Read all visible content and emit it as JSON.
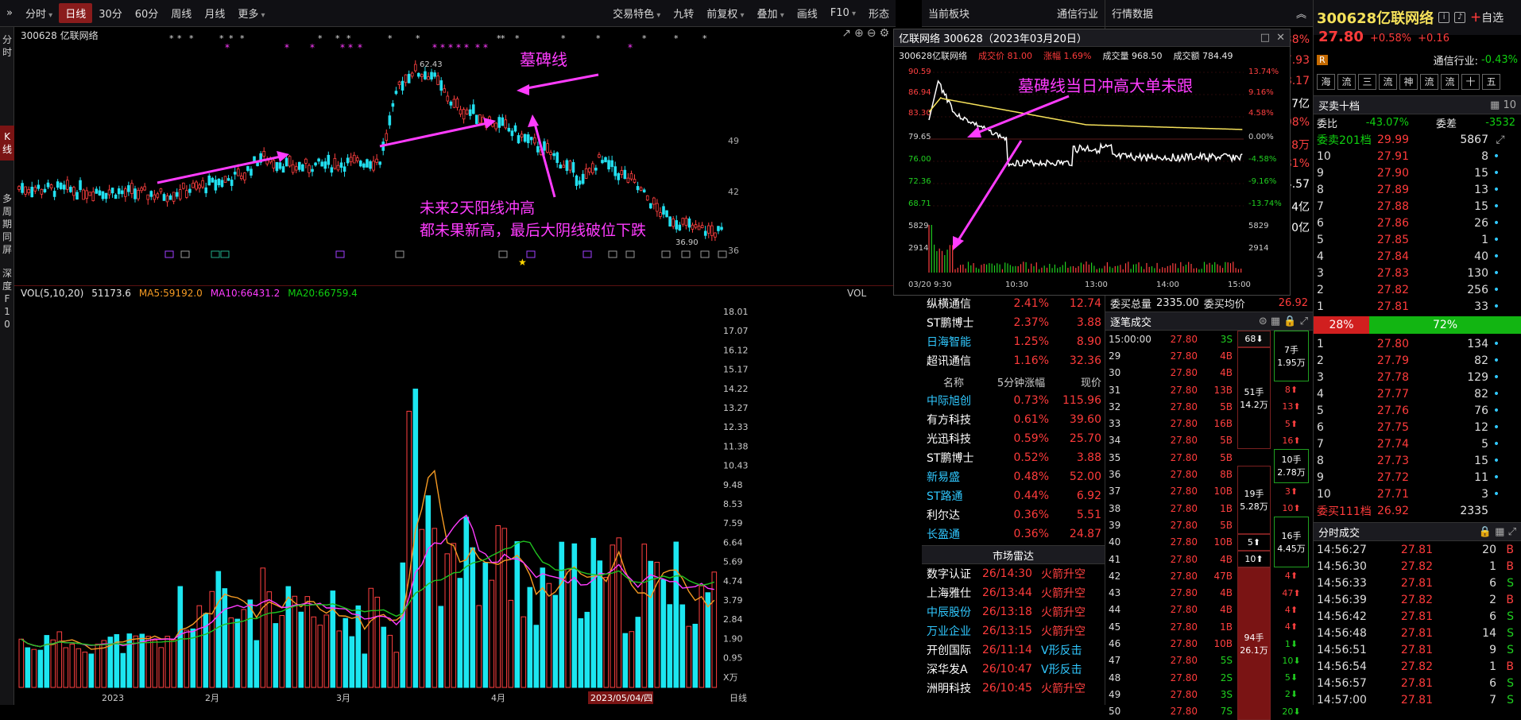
{
  "toolbar": {
    "items": [
      "分时",
      "日线",
      "30分",
      "60分",
      "周线",
      "月线",
      "更多"
    ],
    "active": "日线",
    "right_items": [
      "交易特色",
      "九转",
      "前复权",
      "叠加",
      "画线",
      "F10",
      "形态"
    ]
  },
  "leftbar": [
    "分",
    "时",
    "K",
    "线",
    "多",
    "周",
    "期",
    "同",
    "屏",
    "深",
    "度",
    "F",
    "1",
    "0"
  ],
  "kline": {
    "stock_label": "300628 亿联网络",
    "high_label": "62.43",
    "low_label": "36.90",
    "yaxis": [
      "49",
      "42",
      "36"
    ],
    "annotations": {
      "tomb": "墓碑线",
      "line1": "未来2天阳线冲高",
      "line2": "都未果新高，最后大阴线破位下跌"
    }
  },
  "vol": {
    "title": "VOL(5,10,20)",
    "val": "51173.6",
    "ma5": "MA5:59192.0",
    "ma10": "MA10:66431.2",
    "ma20": "MA20:66759.4",
    "label": "VOL",
    "yaxis": [
      "18.01",
      "17.07",
      "16.12",
      "15.17",
      "14.22",
      "13.27",
      "12.33",
      "11.38",
      "10.43",
      "9.48",
      "8.53",
      "7.59",
      "6.64",
      "5.69",
      "4.74",
      "3.79",
      "2.84",
      "1.90",
      "0.95",
      "X万"
    ],
    "xaxis": [
      "2023",
      "2月",
      "3月",
      "4月",
      "2023/05/04/四",
      "日线"
    ]
  },
  "rtime": {
    "header": "亿联网络 300628（2023年03月20日）",
    "sub_name": "300628亿联网络",
    "price": "成交价 81.00",
    "change": "涨幅 1.69%",
    "volume": "成交量 968.50",
    "amount": "成交额 784.49",
    "annotation": "墓碑线当日冲高大单未跟",
    "yleft": [
      "90.59",
      "86.94",
      "83.30",
      "79.65",
      "76.00",
      "72.36",
      "68.71",
      "5829",
      "2914"
    ],
    "yright": [
      "13.74%",
      "9.16%",
      "4.58%",
      "0.00%",
      "-4.58%",
      "-9.16%",
      "-13.74%",
      "5829",
      "2914"
    ],
    "xaxis": [
      "03/20 9:30",
      "10:30",
      "13:00",
      "14:00",
      "15:00"
    ]
  },
  "mid": {
    "tab1": "当前板块",
    "tab2": "通信行业",
    "sector_rows": [
      {
        "name": "纵横通信",
        "pct": "2.41%",
        "price": "12.74"
      },
      {
        "name": "ST鹏博士",
        "pct": "2.37%",
        "price": "3.88"
      },
      {
        "name": "日海智能",
        "pct": "1.25%",
        "price": "8.90"
      },
      {
        "name": "超讯通信",
        "pct": "1.16%",
        "price": "32.36"
      }
    ],
    "hdr": [
      "名称",
      "5分钟涨幅",
      "现价"
    ],
    "fast_rows": [
      {
        "name": "中际旭创",
        "pct": "0.73%",
        "price": "115.96"
      },
      {
        "name": "有方科技",
        "pct": "0.61%",
        "price": "39.60"
      },
      {
        "name": "光迅科技",
        "pct": "0.59%",
        "price": "25.70"
      },
      {
        "name": "ST鹏博士",
        "pct": "0.52%",
        "price": "3.88"
      },
      {
        "name": "新易盛",
        "pct": "0.48%",
        "price": "52.00"
      },
      {
        "name": "ST路通",
        "pct": "0.44%",
        "price": "6.92"
      },
      {
        "name": "利尔达",
        "pct": "0.36%",
        "price": "5.51"
      },
      {
        "name": "长盈通",
        "pct": "0.36%",
        "price": "24.87"
      }
    ],
    "radar_title": "市场雷达",
    "radar_rows": [
      {
        "name": "数字认证",
        "time": "26/14:30",
        "ev": "火箭升空"
      },
      {
        "name": "上海雅仕",
        "time": "26/13:44",
        "ev": "火箭升空"
      },
      {
        "name": "中辰股份",
        "time": "26/13:18",
        "ev": "火箭升空"
      },
      {
        "name": "万业企业",
        "time": "26/13:15",
        "ev": "火箭升空"
      },
      {
        "name": "开创国际",
        "time": "26/11:14",
        "ev": "V形反击"
      },
      {
        "name": "深华发A",
        "time": "26/10:47",
        "ev": "V形反击"
      },
      {
        "name": "洲明科技",
        "time": "26/10:45",
        "ev": "火箭升空"
      }
    ]
  },
  "trades": {
    "title": "行情数据",
    "partial_rows": [
      {
        "label": "委买总量",
        "val": "2335.00",
        "label2": "委买均价",
        "val2": "26.92"
      }
    ],
    "side_vals": [
      "38%",
      "7.93",
      "8.17",
      "7亿",
      "08%",
      "78万",
      "81%",
      "14.57",
      "4亿",
      "0亿"
    ],
    "ticks_title": "逐笔成交",
    "rows": [
      {
        "t": "15:00:00",
        "p": "27.80",
        "v": "3S"
      },
      {
        "t": "29",
        "p": "27.80",
        "v": "4B"
      },
      {
        "t": "30",
        "p": "27.80",
        "v": "4B"
      },
      {
        "t": "31",
        "p": "27.80",
        "v": "13B"
      },
      {
        "t": "32",
        "p": "27.80",
        "v": "5B"
      },
      {
        "t": "33",
        "p": "27.80",
        "v": "16B"
      },
      {
        "t": "34",
        "p": "27.80",
        "v": "5B"
      },
      {
        "t": "35",
        "p": "27.80",
        "v": "5B"
      },
      {
        "t": "36",
        "p": "27.80",
        "v": "8B"
      },
      {
        "t": "37",
        "p": "27.80",
        "v": "10B"
      },
      {
        "t": "38",
        "p": "27.80",
        "v": "1B"
      },
      {
        "t": "39",
        "p": "27.80",
        "v": "5B"
      },
      {
        "t": "40",
        "p": "27.80",
        "v": "10B"
      },
      {
        "t": "41",
        "p": "27.80",
        "v": "4B"
      },
      {
        "t": "42",
        "p": "27.80",
        "v": "47B"
      },
      {
        "t": "43",
        "p": "27.80",
        "v": "4B"
      },
      {
        "t": "44",
        "p": "27.80",
        "v": "4B"
      },
      {
        "t": "45",
        "p": "27.80",
        "v": "1B"
      },
      {
        "t": "46",
        "p": "27.80",
        "v": "10B"
      },
      {
        "t": "47",
        "p": "27.80",
        "v": "5S"
      },
      {
        "t": "48",
        "p": "27.80",
        "v": "2S"
      },
      {
        "t": "49",
        "p": "27.80",
        "v": "3S"
      },
      {
        "t": "50",
        "p": "27.80",
        "v": "7S"
      }
    ],
    "agg_cols": [
      "68⬇",
      "",
      "",
      "",
      "51手\n14.2万",
      "",
      "",
      "",
      "",
      "19手\n5.28万",
      "",
      "",
      "5⬆",
      "10⬆",
      "",
      "",
      "",
      "",
      "94手\n26.1万"
    ],
    "right_col": [
      "7手\n1.95万",
      "8⬆",
      "13⬆",
      "5⬆",
      "16⬆",
      "10手\n2.78万",
      "3⬆",
      "10⬆",
      "16手\n4.45万",
      "",
      "",
      "4⬆",
      "47⬆",
      "4⬆",
      "4⬆",
      "1⬇",
      "10⬇",
      "5⬇",
      "2⬇",
      "3⬇",
      "20⬇"
    ]
  },
  "right": {
    "code_name": "300628亿联网络",
    "watch": "自选",
    "price": "27.80",
    "pct": "+0.58%",
    "chg": "+0.16",
    "industry": "通信行业:",
    "industry_pct": "-0.43%",
    "badges": [
      "海",
      "流",
      "三",
      "流",
      "神",
      "流",
      "流",
      "十",
      "五"
    ],
    "book_title": "买卖十档",
    "weibi_label": "委比",
    "weibi": "-43.07%",
    "weicha_label": "委差",
    "weicha": "-3532",
    "sell_sum_label": "委卖201档",
    "sell_sum_price": "29.99",
    "sell_sum_vol": "5867",
    "sells": [
      {
        "i": "10",
        "p": "27.91",
        "v": "8"
      },
      {
        "i": "9",
        "p": "27.90",
        "v": "15"
      },
      {
        "i": "8",
        "p": "27.89",
        "v": "13"
      },
      {
        "i": "7",
        "p": "27.88",
        "v": "15"
      },
      {
        "i": "6",
        "p": "27.86",
        "v": "26"
      },
      {
        "i": "5",
        "p": "27.85",
        "v": "1"
      },
      {
        "i": "4",
        "p": "27.84",
        "v": "40"
      },
      {
        "i": "3",
        "p": "27.83",
        "v": "130"
      },
      {
        "i": "2",
        "p": "27.82",
        "v": "256"
      },
      {
        "i": "1",
        "p": "27.81",
        "v": "33"
      }
    ],
    "ratio_left": "28%",
    "ratio_right": "72%",
    "buys": [
      {
        "i": "1",
        "p": "27.80",
        "v": "134"
      },
      {
        "i": "2",
        "p": "27.79",
        "v": "82"
      },
      {
        "i": "3",
        "p": "27.78",
        "v": "129"
      },
      {
        "i": "4",
        "p": "27.77",
        "v": "82"
      },
      {
        "i": "5",
        "p": "27.76",
        "v": "76"
      },
      {
        "i": "6",
        "p": "27.75",
        "v": "12"
      },
      {
        "i": "7",
        "p": "27.74",
        "v": "5"
      },
      {
        "i": "8",
        "p": "27.73",
        "v": "15"
      },
      {
        "i": "9",
        "p": "27.72",
        "v": "11"
      },
      {
        "i": "10",
        "p": "27.71",
        "v": "3"
      }
    ],
    "buy_sum_label": "委买111档",
    "buy_sum_price": "26.92",
    "buy_sum_vol": "2335",
    "ticks_title": "分时成交",
    "ticks": [
      {
        "t": "14:56:27",
        "p": "27.81",
        "v": "20",
        "s": "B"
      },
      {
        "t": "14:56:30",
        "p": "27.82",
        "v": "1",
        "s": "B"
      },
      {
        "t": "14:56:33",
        "p": "27.81",
        "v": "6",
        "s": "S"
      },
      {
        "t": "14:56:39",
        "p": "27.82",
        "v": "2",
        "s": "B"
      },
      {
        "t": "14:56:42",
        "p": "27.81",
        "v": "6",
        "s": "S"
      },
      {
        "t": "14:56:48",
        "p": "27.81",
        "v": "14",
        "s": "S"
      },
      {
        "t": "14:56:51",
        "p": "27.81",
        "v": "9",
        "s": "S"
      },
      {
        "t": "14:56:54",
        "p": "27.82",
        "v": "1",
        "s": "B"
      },
      {
        "t": "14:56:57",
        "p": "27.81",
        "v": "6",
        "s": "S"
      },
      {
        "t": "14:57:00",
        "p": "27.81",
        "v": "7",
        "s": "S"
      }
    ]
  }
}
